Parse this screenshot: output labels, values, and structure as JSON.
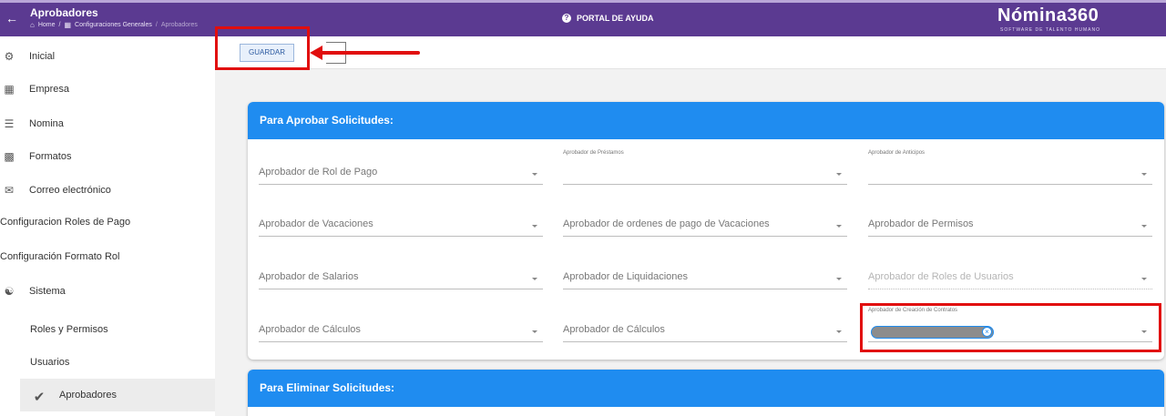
{
  "header": {
    "back_icon": "arrow-left-icon",
    "title": "Aprobadores",
    "breadcrumb": [
      "Home",
      "Configuraciones Generales",
      "Aprobadores"
    ],
    "help_label": "PORTAL DE AYUDA",
    "brand_name": "Nómina360",
    "brand_tagline": "SOFTWARE DE TALENTO HUMANO",
    "color": "#5b3a91"
  },
  "sidebar": {
    "items": [
      {
        "label": "Inicial",
        "icon": "gear-icon"
      },
      {
        "label": "Empresa",
        "icon": "building-icon"
      },
      {
        "label": "Nomina",
        "icon": "list-icon"
      },
      {
        "label": "Formatos",
        "icon": "folder-icon"
      },
      {
        "label": "Correo electrónico",
        "icon": "envelope-icon"
      },
      {
        "label": "Configuracion Roles de Pago"
      },
      {
        "label": "Configuración Formato Rol"
      },
      {
        "label": "Sistema",
        "icon": "users-icon"
      },
      {
        "label": "Roles y Permisos"
      },
      {
        "label": "Usuarios"
      },
      {
        "label": "Aprobadores",
        "icon": "check-icon",
        "active": true
      }
    ]
  },
  "toolbar": {
    "save_label": "GUARDAR"
  },
  "sections": {
    "approve": {
      "title": "Para Aprobar Solicitudes:",
      "fields": [
        {
          "label": "Aprobador de Rol de Pago"
        },
        {
          "label": "Aprobador de Préstamos",
          "floating": true
        },
        {
          "label": "Aprobador de Anticipos",
          "floating": true
        },
        {
          "label": "Aprobador de Vacaciones"
        },
        {
          "label": "Aprobador de ordenes de pago de Vacaciones"
        },
        {
          "label": "Aprobador de Permisos"
        },
        {
          "label": "Aprobador de Salarios"
        },
        {
          "label": "Aprobador de Liquidaciones"
        },
        {
          "label": "Aprobador de Roles de Usuarios",
          "disabled": true
        },
        {
          "label": "Aprobador de Cálculos"
        },
        {
          "label": "Aprobador de Cálculos"
        },
        {
          "label": "Aprobador de Creación de Contratos",
          "floating": true,
          "chip": true
        }
      ]
    },
    "delete": {
      "title": "Para Eliminar Solicitudes:"
    }
  },
  "colors": {
    "accent": "#1f8cf0",
    "annotation": "#e10e0e"
  }
}
